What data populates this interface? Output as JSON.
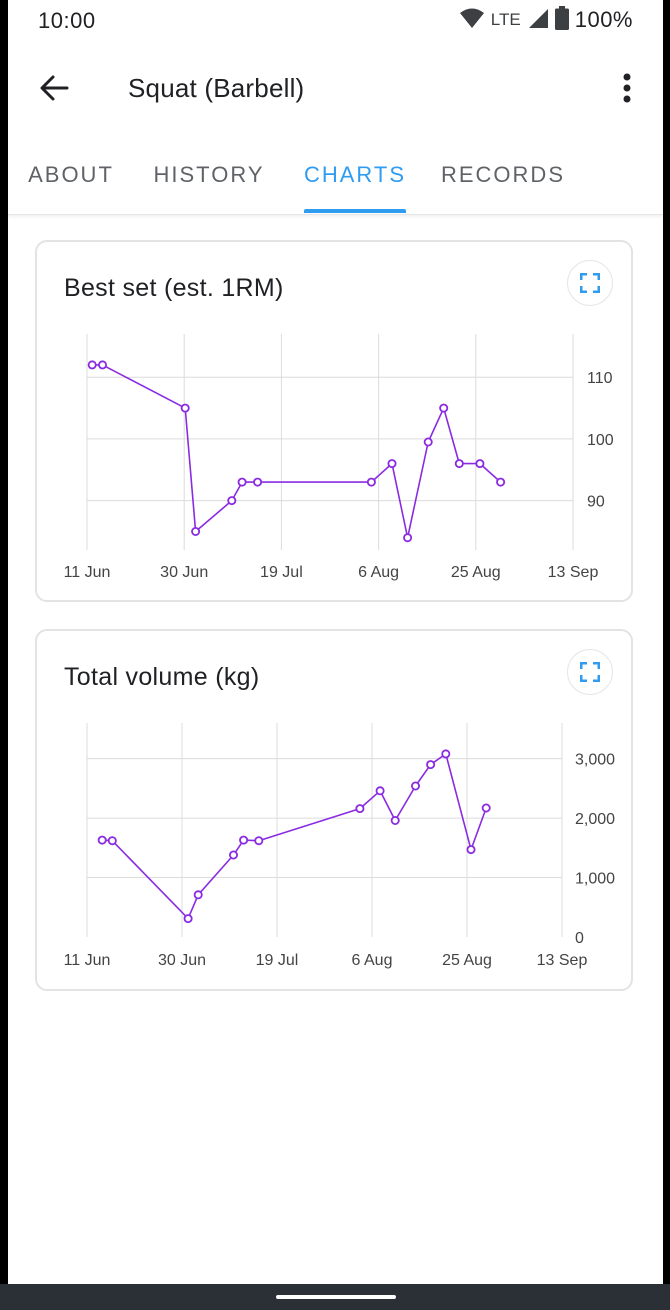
{
  "status_bar": {
    "time": "10:00",
    "network": "LTE",
    "battery": "100%"
  },
  "app_bar": {
    "title": "Squat (Barbell)",
    "back_icon": "arrow-back-icon",
    "menu_icon": "more-vert-icon"
  },
  "tabs": [
    {
      "label": "ABOUT",
      "active": false
    },
    {
      "label": "HISTORY",
      "active": false
    },
    {
      "label": "CHARTS",
      "active": true
    },
    {
      "label": "RECORDS",
      "active": false
    }
  ],
  "colors": {
    "accent": "#2f9cf0",
    "series": "#8a2be2",
    "text": "#202124"
  },
  "charts": {
    "best_set": {
      "title": "Best set (est. 1RM)",
      "expand_icon": "fullscreen-icon"
    },
    "total_volume": {
      "title": "Total volume (kg)",
      "expand_icon": "fullscreen-icon"
    }
  },
  "chart_data": [
    {
      "type": "line",
      "title": "Best set (est. 1RM)",
      "xlabel": "",
      "ylabel": "",
      "x_ticks": [
        "11 Jun",
        "30 Jun",
        "19 Jul",
        "6 Aug",
        "25 Aug",
        "13 Sep"
      ],
      "y_ticks": [
        "90",
        "100",
        "110"
      ],
      "ylim": [
        82,
        117
      ],
      "x": [
        "2023-06-12",
        "2023-06-14",
        "2023-06-30",
        "2023-07-02",
        "2023-07-09",
        "2023-07-11",
        "2023-07-14",
        "2023-08-05",
        "2023-08-09",
        "2023-08-12",
        "2023-08-16",
        "2023-08-19",
        "2023-08-22",
        "2023-08-26",
        "2023-08-30"
      ],
      "values": [
        112,
        112,
        105,
        85,
        90,
        93,
        93,
        93,
        96,
        84,
        99.5,
        105,
        96,
        96,
        93
      ],
      "grid": true
    },
    {
      "type": "line",
      "title": "Total volume (kg)",
      "xlabel": "",
      "ylabel": "",
      "x_ticks": [
        "11 Jun",
        "30 Jun",
        "19 Jul",
        "6 Aug",
        "25 Aug",
        "13 Sep"
      ],
      "y_ticks": [
        "0",
        "1,000",
        "2,000",
        "3,000"
      ],
      "ylim": [
        0,
        3600
      ],
      "x": [
        "2023-06-14",
        "2023-06-16",
        "2023-07-01",
        "2023-07-03",
        "2023-07-10",
        "2023-07-12",
        "2023-07-15",
        "2023-08-04",
        "2023-08-08",
        "2023-08-11",
        "2023-08-15",
        "2023-08-18",
        "2023-08-21",
        "2023-08-26",
        "2023-08-29"
      ],
      "values": [
        1630,
        1620,
        310,
        710,
        1380,
        1630,
        1620,
        2160,
        2460,
        1960,
        2540,
        2900,
        3080,
        1470,
        2170
      ],
      "grid": true
    }
  ]
}
